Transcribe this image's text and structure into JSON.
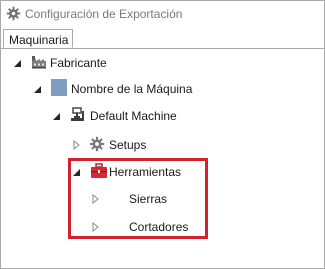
{
  "window": {
    "title": "Configuración de Exportación",
    "title_icon": "gear-icon"
  },
  "tabs": [
    {
      "label": "Maquinaria",
      "selected": true
    }
  ],
  "tree": {
    "fabricante": {
      "label": "Fabricante",
      "icon": "factory-icon",
      "expanded": true
    },
    "machine_name": {
      "label": "Nombre de la Máquina",
      "icon": "blue-square-icon",
      "expanded": true
    },
    "default_machine": {
      "label": "Default Machine",
      "icon": "machine-tool-icon",
      "expanded": true
    },
    "setups": {
      "label": "Setups",
      "icon": "gear-icon",
      "expanded": false
    },
    "herramientas": {
      "label": "Herramientas",
      "icon": "toolbox-icon",
      "expanded": true
    },
    "sierras": {
      "label": "Sierras",
      "expanded": false
    },
    "cortadores": {
      "label": "Cortadores",
      "expanded": false
    }
  },
  "colors": {
    "highlight_border": "#d3212d",
    "toolbox": "#d9282f",
    "machine_name_square": "#7f9cc2"
  }
}
